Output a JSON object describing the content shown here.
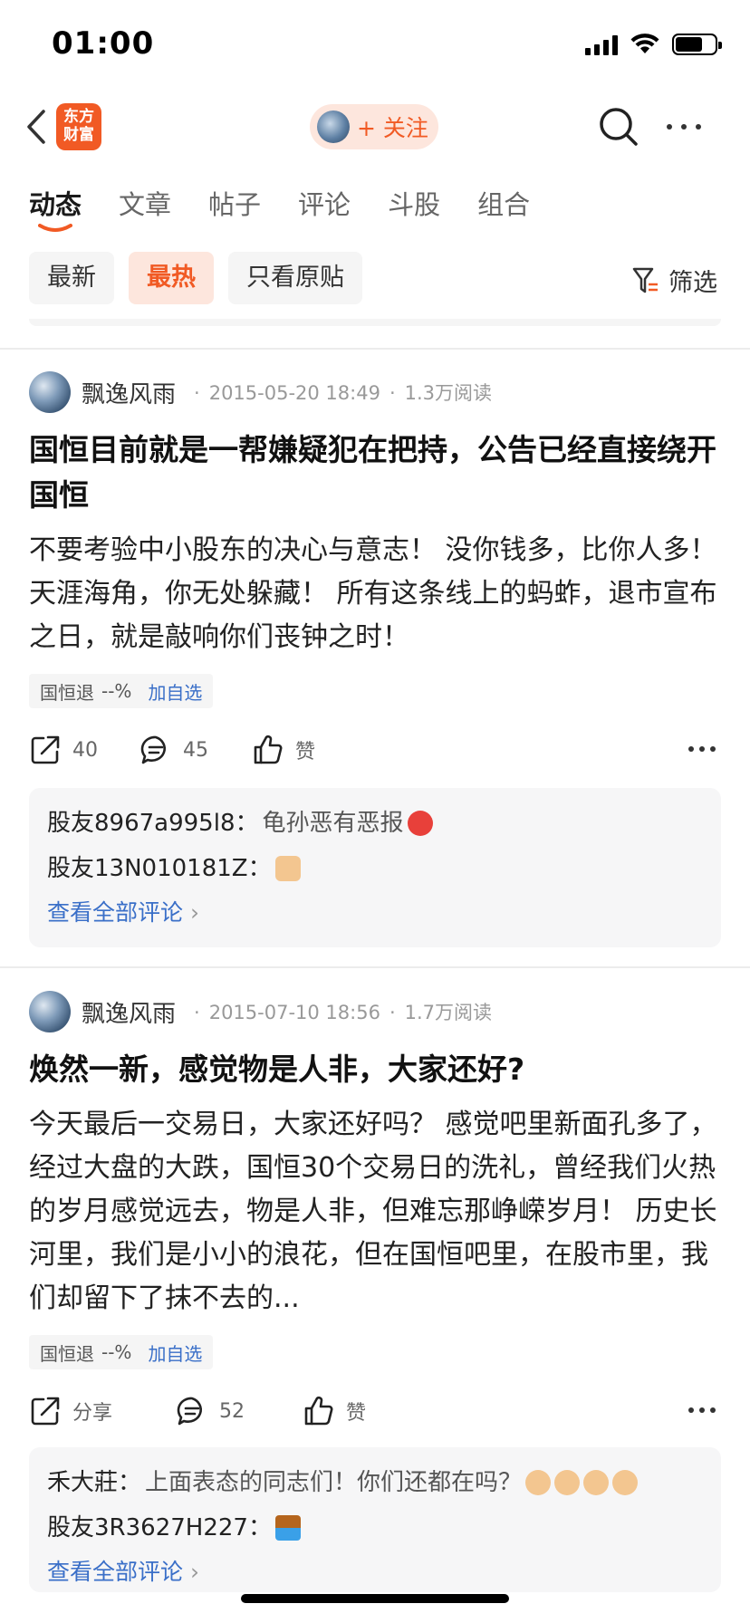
{
  "status_bar": {
    "time": "01:00"
  },
  "nav": {
    "logo_text": "东方\n财富",
    "follow_label": "+ 关注"
  },
  "tabs": [
    {
      "label": "动态"
    },
    {
      "label": "文章"
    },
    {
      "label": "帖子"
    },
    {
      "label": "评论"
    },
    {
      "label": "斗股"
    },
    {
      "label": "组合"
    }
  ],
  "chips": [
    {
      "label": "最新"
    },
    {
      "label": "最热"
    },
    {
      "label": "只看原贴"
    }
  ],
  "filter_label": "筛选",
  "accent_color": "#f15a24",
  "posts": [
    {
      "author": "飘逸风雨",
      "date": "2015-05-20 18:49",
      "reads": "1.3万阅读",
      "title": "国恒目前就是一帮嫌疑犯在把持，公告已经直接绕开国恒",
      "body": "不要考验中小股东的决心与意志！ 没你钱多，比你人多！ 天涯海角，你无处躲藏！ 所有这条线上的蚂蚱，退市宣布之日，就是敲响你们丧钟之时！",
      "stock": {
        "name": "国恒退",
        "change": "--%",
        "add": "加自选"
      },
      "actions": {
        "share": "40",
        "comment": "45",
        "like": "赞"
      },
      "comments": [
        {
          "user": "股友8967a995l8",
          "text": "龟孙恶有恶报",
          "emoji": "angry-face"
        },
        {
          "user": "股友13N010181Z",
          "text": "",
          "emoji": "thumbs-up"
        }
      ],
      "view_all": "查看全部评论"
    },
    {
      "author": "飘逸风雨",
      "date": "2015-07-10 18:56",
      "reads": "1.7万阅读",
      "title": "焕然一新，感觉物是人非，大家还好?",
      "body": "今天最后一交易日，大家还好吗？ 感觉吧里新面孔多了，经过大盘的大跌，国恒30个交易日的洗礼，曾经我们火热的岁月感觉远去，物是人非，但难忘那峥嵘岁月！ 历史长河里，我们是小小的浪花，但在国恒吧里，在股市里，我们却留下了抹不去的...",
      "stock": {
        "name": "国恒退",
        "change": "--%",
        "add": "加自选"
      },
      "actions": {
        "share": "分享",
        "comment": "52",
        "like": "赞"
      },
      "comments": [
        {
          "user": "禾大莊",
          "text": "上面表态的同志们！你们还都在吗？",
          "emoji": "victory-hand"
        },
        {
          "user": "股友3R3627H227",
          "text": "",
          "emoji": "wall-water"
        }
      ],
      "view_all": "查看全部评论"
    }
  ]
}
